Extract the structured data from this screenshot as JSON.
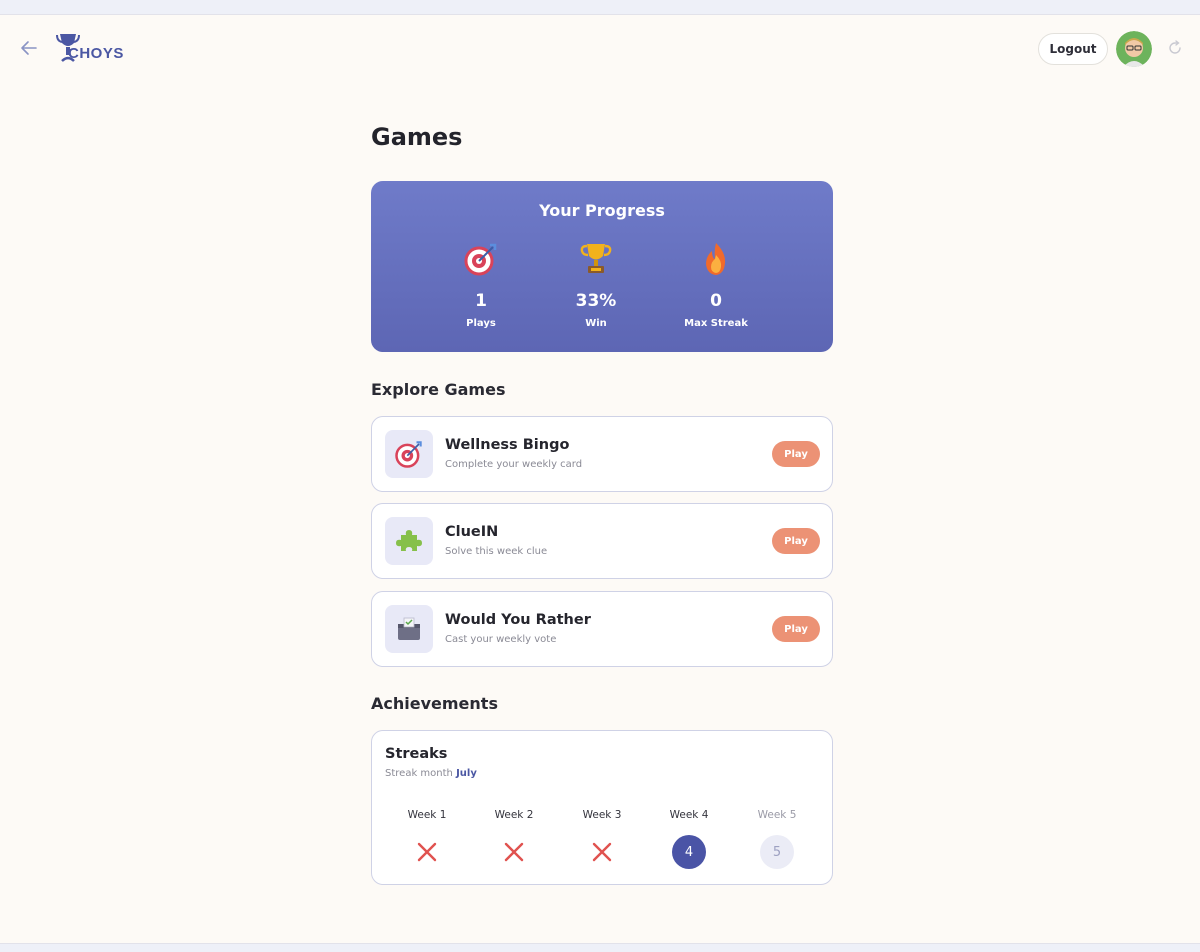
{
  "header": {
    "logo_text": "CHOYS",
    "logout_label": "Logout"
  },
  "icons": {
    "back": "arrow-left-icon",
    "refresh": "refresh-icon",
    "plays": "dart-target-icon",
    "win": "trophy-icon",
    "streak": "fire-icon"
  },
  "page": {
    "title": "Games"
  },
  "progress": {
    "title": "Your Progress",
    "stats": [
      {
        "value": "1",
        "label": "Plays"
      },
      {
        "value": "33%",
        "label": "Win"
      },
      {
        "value": "0",
        "label": "Max Streak"
      }
    ]
  },
  "explore": {
    "title": "Explore Games",
    "games": [
      {
        "name": "Wellness Bingo",
        "desc": "Complete your weekly card",
        "action": "Play",
        "icon": "dart-target-icon"
      },
      {
        "name": "ClueIN",
        "desc": "Solve this week clue",
        "action": "Play",
        "icon": "puzzle-piece-icon"
      },
      {
        "name": "Would You Rather",
        "desc": "Cast your weekly vote",
        "action": "Play",
        "icon": "ballot-box-icon"
      }
    ]
  },
  "achievements": {
    "title": "Achievements",
    "streaks": {
      "title": "Streaks",
      "subtitle_prefix": "Streak month",
      "month": "July",
      "weeks": [
        {
          "label": "Week 1",
          "status": "missed"
        },
        {
          "label": "Week 2",
          "status": "missed"
        },
        {
          "label": "Week 3",
          "status": "missed"
        },
        {
          "label": "Week 4",
          "status": "current",
          "number": "4"
        },
        {
          "label": "Week 5",
          "status": "future",
          "number": "5"
        }
      ]
    }
  },
  "colors": {
    "accent": "#5d66b4",
    "play_button": "#ec9275",
    "missed": "#e0524f"
  }
}
